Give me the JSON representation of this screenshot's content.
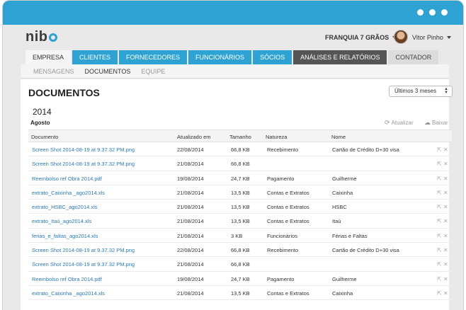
{
  "brand": {
    "logo_text": "nib",
    "accent": "#2ea3d3"
  },
  "header": {
    "company": "FRANQUIA 7 GRÃOS",
    "user": "Vitor Pinho"
  },
  "main_tabs": [
    {
      "label": "EMPRESA"
    },
    {
      "label": "CLIENTES"
    },
    {
      "label": "FORNECEDORES"
    },
    {
      "label": "FUNCIONÁRIOS"
    },
    {
      "label": "SÓCIOS"
    },
    {
      "label": "ANÁLISES E RELATÓRIOS"
    },
    {
      "label": "CONTADOR"
    }
  ],
  "sub_tabs": [
    {
      "label": "MENSAGENS"
    },
    {
      "label": "DOCUMENTOS"
    },
    {
      "label": "EQUIPE"
    }
  ],
  "page": {
    "title": "DOCUMENTOS",
    "period_select": "Últimos 3 meses",
    "year": "2014",
    "month": "Agosto",
    "refresh_label": "Atualizar",
    "download_label": "Baixar"
  },
  "table": {
    "headers": {
      "document": "Documento",
      "updated": "Atualizado em",
      "size": "Tamanho",
      "nature": "Natureza",
      "name": "Nome"
    },
    "rows": [
      {
        "document": "Screen Shot 2014-08-19 at 9.37.32 PM.png",
        "updated": "22/08/2014",
        "size": "66,8 KB",
        "nature": "Recebimento",
        "name": "Cartão de Crédito D+30 visa"
      },
      {
        "document": "Screen Shot 2014-08-19 at 9.37.32 PM.png",
        "updated": "21/08/2014",
        "size": "66,8 KB",
        "nature": "",
        "name": ""
      },
      {
        "document": "Reembolso ref Obra 2014.pdf",
        "updated": "19/08/2014",
        "size": "24,7 KB",
        "nature": "Pagamento",
        "name": "Guilherme"
      },
      {
        "document": "extrato_Caixinha _ago2014.xls",
        "updated": "21/08/2014",
        "size": "13,5 KB",
        "nature": "Contas e Extratos",
        "name": "Caixinha"
      },
      {
        "document": "extrato_HSBC_ago2014.xls",
        "updated": "21/08/2014",
        "size": "13,5 KB",
        "nature": "Contas e Extratos",
        "name": "HSBC"
      },
      {
        "document": "extrato_Itaú_ago2014.xls",
        "updated": "21/08/2014",
        "size": "13,5 KB",
        "nature": "Contas e Extratos",
        "name": "Itaú"
      },
      {
        "document": "ferias_e_faltas_ago2014.xls",
        "updated": "21/08/2014",
        "size": "3 KB",
        "nature": "Funcionários",
        "name": "Férias e Faltas"
      },
      {
        "document": "Screen Shot 2014-08-19 at 9.37.32 PM.png",
        "updated": "22/08/2014",
        "size": "66,8 KB",
        "nature": "Recebimento",
        "name": "Cartão de Crédito D+30 visa"
      },
      {
        "document": "Screen Shot 2014-08-19 at 9.37.32 PM.png",
        "updated": "21/08/2014",
        "size": "66,8 KB",
        "nature": "",
        "name": ""
      },
      {
        "document": "Reembolso ref Obra 2014.pdf",
        "updated": "19/08/2014",
        "size": "24,7 KB",
        "nature": "Pagamento",
        "name": "Guilherme"
      },
      {
        "document": "extrato_Caixinha _ago2014.xls",
        "updated": "21/08/2014",
        "size": "13,5 KB",
        "nature": "Contas e Extratos",
        "name": "Caixinha"
      }
    ]
  }
}
